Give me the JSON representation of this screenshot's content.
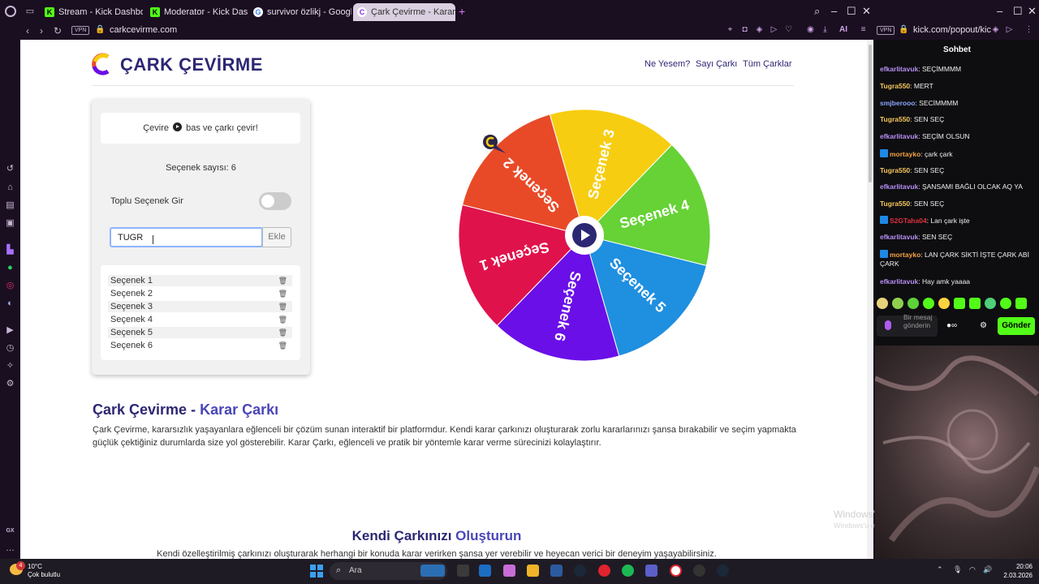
{
  "browser": {
    "tabs": [
      {
        "label": "Stream - Kick Dashboard",
        "favicon": "K"
      },
      {
        "label": "Moderator - Kick Dashbo",
        "favicon": "K"
      },
      {
        "label": "survivor özlikj - Google'd",
        "favicon": "G"
      },
      {
        "label": "Çark Çevirme - Karar Çark",
        "favicon": "C"
      }
    ],
    "url": "carkcevirme.com",
    "vpn_label": "VPN",
    "ai_label": "AI",
    "popout_url": "kick.com/popout/kic"
  },
  "site": {
    "brand": "ÇARK ÇEVİRME",
    "nav": [
      "Ne Yesem?",
      "Sayı Çarkı",
      "Tüm Çarklar"
    ],
    "hint_before": "Çevire",
    "hint_after": "bas ve çarkı çevir!",
    "count_label": "Seçenek sayısı: 6",
    "bulk_label": "Toplu Seçenek Gir",
    "bulk_enabled": false,
    "input_value": "TUGR",
    "add_label": "Ekle",
    "options": [
      "Seçenek 1",
      "Seçenek 2",
      "Seçenek 3",
      "Seçenek 4",
      "Seçenek 5",
      "Seçenek 6"
    ],
    "section1_title_a": "Çark Çevirme -",
    "section1_title_b": "Karar Çarkı",
    "section1_text": "Çark Çevirme, kararsızlık yaşayanlara eğlenceli bir çözüm sunan interaktif bir platformdur. Kendi karar çarkınızı oluşturarak zorlu kararlarınızı şansa bırakabilir ve seçim yapmakta güçlük çektiğiniz durumlarda size yol gösterebilir. Karar Çarkı, eğlenceli ve pratik bir yöntemle karar verme sürecinizi kolaylaştırır.",
    "section2_title_a": "Kendi Çarkınızı",
    "section2_title_b": "Oluşturun",
    "section2_text": "Kendi özelleştirilmiş çarkınızı oluşturarak herhangi bir konuda karar verirken şansa yer verebilir ve heyecan verici bir deneyim yaşayabilirsiniz."
  },
  "wheel": {
    "segments": [
      {
        "label": "Seçenek 3",
        "color": "#f7cd12"
      },
      {
        "label": "Seçenek 4",
        "color": "#66d236"
      },
      {
        "label": "Seçenek 5",
        "color": "#1f8fe0"
      },
      {
        "label": "Seçenek 6",
        "color": "#6a0fe8"
      },
      {
        "label": "Seçenek 1",
        "color": "#e0124c"
      },
      {
        "label": "Seçenek 2",
        "color": "#e84a27"
      }
    ]
  },
  "chat": {
    "title": "Sohbet",
    "messages": [
      {
        "user": "efkarlitavuk",
        "text": "SEÇİMMMM",
        "color": "#b98ef5",
        "badge": false
      },
      {
        "user": "Tugra550",
        "text": "MERT",
        "color": "#f6c65b",
        "badge": false
      },
      {
        "user": "smjberooo",
        "text": "SECİMMMM",
        "color": "#8aa7ff",
        "badge": false
      },
      {
        "user": "Tugra550",
        "text": "SEN SEÇ",
        "color": "#f6c65b",
        "badge": false
      },
      {
        "user": "efkarlitavuk",
        "text": "SEÇİM OLSUN",
        "color": "#b98ef5",
        "badge": false
      },
      {
        "user": "mortayko",
        "text": "çark çark",
        "color": "#f5a142",
        "badge": true
      },
      {
        "user": "Tugra550",
        "text": "SEN SEÇ",
        "color": "#f6c65b",
        "badge": false
      },
      {
        "user": "efkarlitavuk",
        "text": "ŞANSAMI BAĞLI OLCAK AQ YA",
        "color": "#b98ef5",
        "badge": false
      },
      {
        "user": "Tugra550",
        "text": "SEN SEÇ",
        "color": "#f6c65b",
        "badge": false
      },
      {
        "user": "S2GTaha04",
        "text": "Lan çark işte",
        "color": "#e0303f",
        "badge": true
      },
      {
        "user": "efkarlitavuk",
        "text": "SEN SEÇ",
        "color": "#b98ef5",
        "badge": false
      },
      {
        "user": "mortayko",
        "text": "LAN ÇARK SİKTİ İŞTE ÇARK ABİ ÇARK",
        "color": "#f5a142",
        "badge": true
      },
      {
        "user": "efkarlitavuk",
        "text": "Hay amk yaaaa",
        "color": "#b98ef5",
        "badge": false
      }
    ],
    "input_placeholder": "Bir mesaj gönderin",
    "send_label": "Gönder"
  },
  "watermark": {
    "line1": "Windows'u Etkinleştir",
    "line2": "Windows'u etkinleştirmek için Ayarlar'a gidin."
  },
  "taskbar": {
    "weather_temp": "10°C",
    "weather_desc": "Çok bulutlu",
    "weather_badge": "4",
    "search_placeholder": "Ara",
    "time": "20:06",
    "date": "2.03.2026"
  }
}
